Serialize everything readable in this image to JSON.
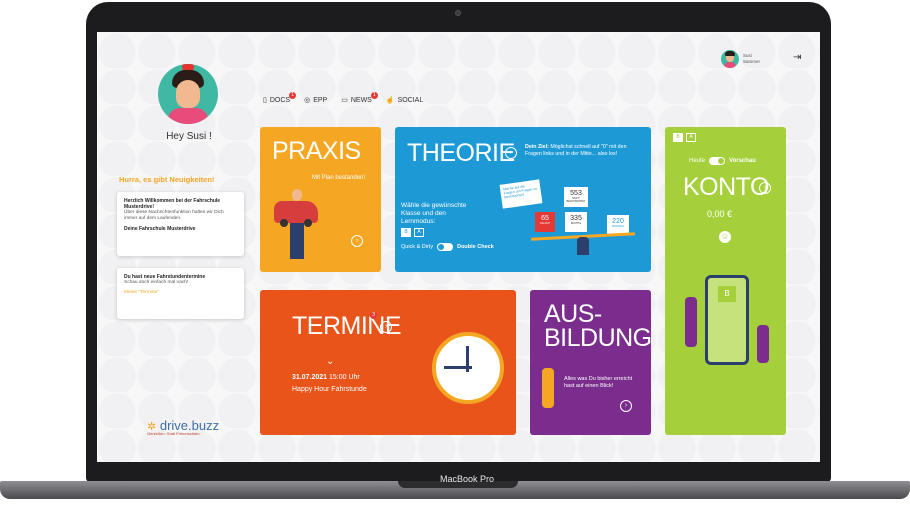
{
  "device": {
    "label": "MacBook Pro"
  },
  "user": {
    "first": "Susi",
    "last": "Sammer"
  },
  "sidebar": {
    "greeting": "Hey Susi !",
    "news_heading": "Hurra, es gibt Neuigkeiten!",
    "card1": {
      "title": "Herzlich Willkommen bei der Fahrschule Musterdrive!",
      "body": "Über diese Nachrichtenfunktion halten wir Dich immer auf dem Laufenden.",
      "signature": "Deine Fahrschule Musterdrive"
    },
    "card2": {
      "title": "Du hast neue Fahrstundentermine",
      "body": "Schau doch einfach mal nach!",
      "link": "Meine \"Termine\""
    },
    "logo": {
      "name": "drive.buzz",
      "tagline": "Genießen. Statt Führerschein."
    }
  },
  "nav": {
    "items": [
      {
        "label": "DOCS",
        "badge": "1"
      },
      {
        "label": "EPP",
        "badge": ""
      },
      {
        "label": "NEWS",
        "badge": "1"
      },
      {
        "label": "SOCIAL",
        "badge": ""
      }
    ]
  },
  "praxis": {
    "title": "PRAXIS",
    "subtitle": "Mit Plan bestanden!"
  },
  "theorie": {
    "title": "THEORIE",
    "goal_bold": "Dein Ziel:",
    "goal_text": "Möglichst schnell auf \"0\" mit den Fragen links und in der Mitte... also los!",
    "choose": "Wähle die gewünschte Klasse und den Lernmodus:",
    "class_b": "B",
    "class_a": "A",
    "mode_left": "Quick & Dirty",
    "mode_right": "Double Check",
    "bubble": "Mache auf die Fragen um Fragen zu beantworten!",
    "num_red": "65",
    "num_red_label": "FALSCH",
    "num_mid": "335",
    "num_mid_label": "RICHTIG",
    "num_top": "553",
    "num_top_label": "NICHT BEANTWORTET",
    "num_right": "220",
    "num_right_label": "NOCHMAL"
  },
  "konto": {
    "toggle_b": "B",
    "toggle_a": "A",
    "heute": "Heute",
    "vorschau": "Vorschau",
    "title": "KONTO",
    "amount": "0,00 €",
    "phone_letter": "B"
  },
  "termine": {
    "title": "TERMINE",
    "badge": "3",
    "date": "31.07.2021",
    "time": "15:00 Uhr",
    "event": "Happy Hour Fahrstunde"
  },
  "ausbildung": {
    "title_line1": "AUS-",
    "title_line2": "BILDUNG",
    "subtitle": "Alles was Du bisher erreicht hast auf einen Blick!"
  },
  "colors": {
    "praxis": "#f5a623",
    "theorie": "#1d9ad6",
    "konto": "#a5cf3b",
    "termine": "#e8541a",
    "ausbildung": "#7b2d8e"
  }
}
